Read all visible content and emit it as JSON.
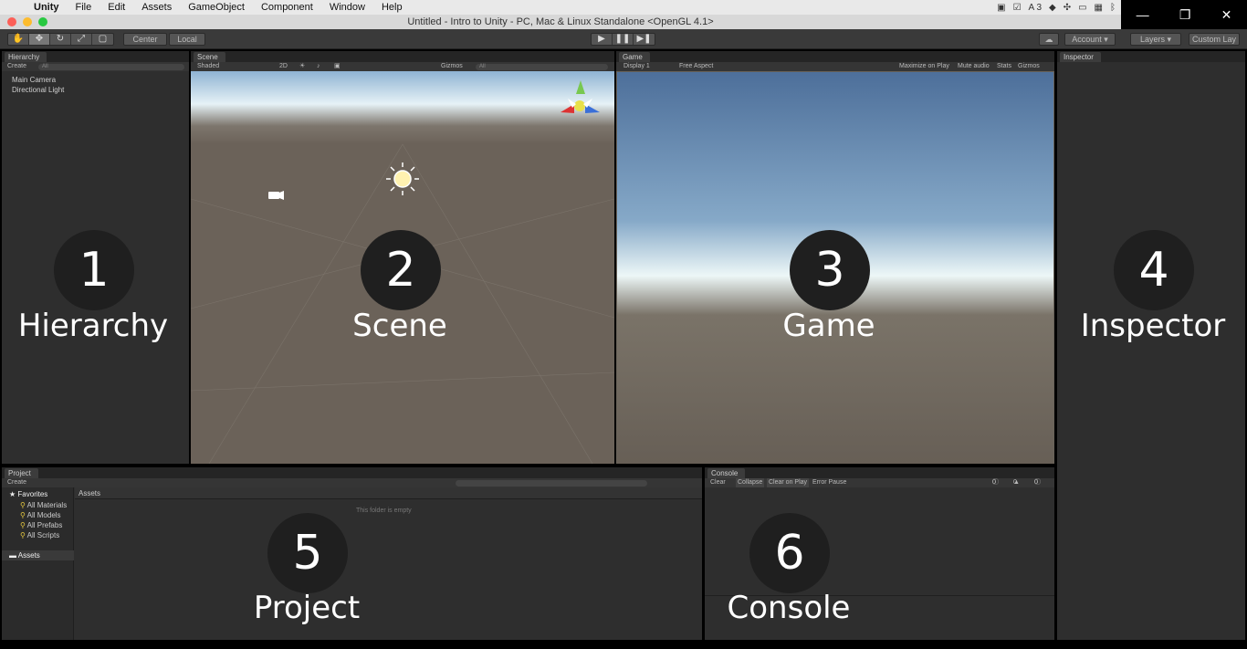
{
  "menubar": {
    "app": "Unity",
    "items": [
      "File",
      "Edit",
      "Assets",
      "GameObject",
      "Component",
      "Window",
      "Help"
    ],
    "status_text": "3"
  },
  "titlebar": {
    "title": "Untitled - Intro to Unity - PC, Mac & Linux Standalone <OpenGL 4.1>"
  },
  "toolbar": {
    "pivot": "Center",
    "space": "Local",
    "account": "Account",
    "layers": "Layers",
    "layout": "Custom Lay"
  },
  "hierarchy": {
    "tab": "Hierarchy",
    "create": "Create",
    "search_placeholder": "All",
    "items": [
      "Main Camera",
      "Directional Light"
    ]
  },
  "scene": {
    "tab": "Scene",
    "shading": "Shaded",
    "mode2d": "2D",
    "gizmos": "Gizmos",
    "search_placeholder": "All"
  },
  "game": {
    "tab": "Game",
    "display": "Display 1",
    "aspect": "Free Aspect",
    "maximize": "Maximize on Play",
    "mute": "Mute audio",
    "stats": "Stats",
    "gizmos": "Gizmos"
  },
  "inspector": {
    "tab": "Inspector"
  },
  "project": {
    "tab": "Project",
    "create": "Create",
    "favorites": "Favorites",
    "fav_items": [
      "All Materials",
      "All Models",
      "All Prefabs",
      "All Scripts"
    ],
    "assets": "Assets",
    "breadcrumb": "Assets",
    "empty": "This folder is empty"
  },
  "console": {
    "tab": "Console",
    "clear": "Clear",
    "collapse": "Collapse",
    "clear_on_play": "Clear on Play",
    "error_pause": "Error Pause",
    "count_info": "0",
    "count_warn": "0",
    "count_err": "0"
  },
  "overlays": {
    "n1": "1",
    "l1": "Hierarchy",
    "n2": "2",
    "l2": "Scene",
    "n3": "3",
    "l3": "Game",
    "n4": "4",
    "l4": "Inspector",
    "n5": "5",
    "l5": "Project",
    "n6": "6",
    "l6": "Console"
  }
}
